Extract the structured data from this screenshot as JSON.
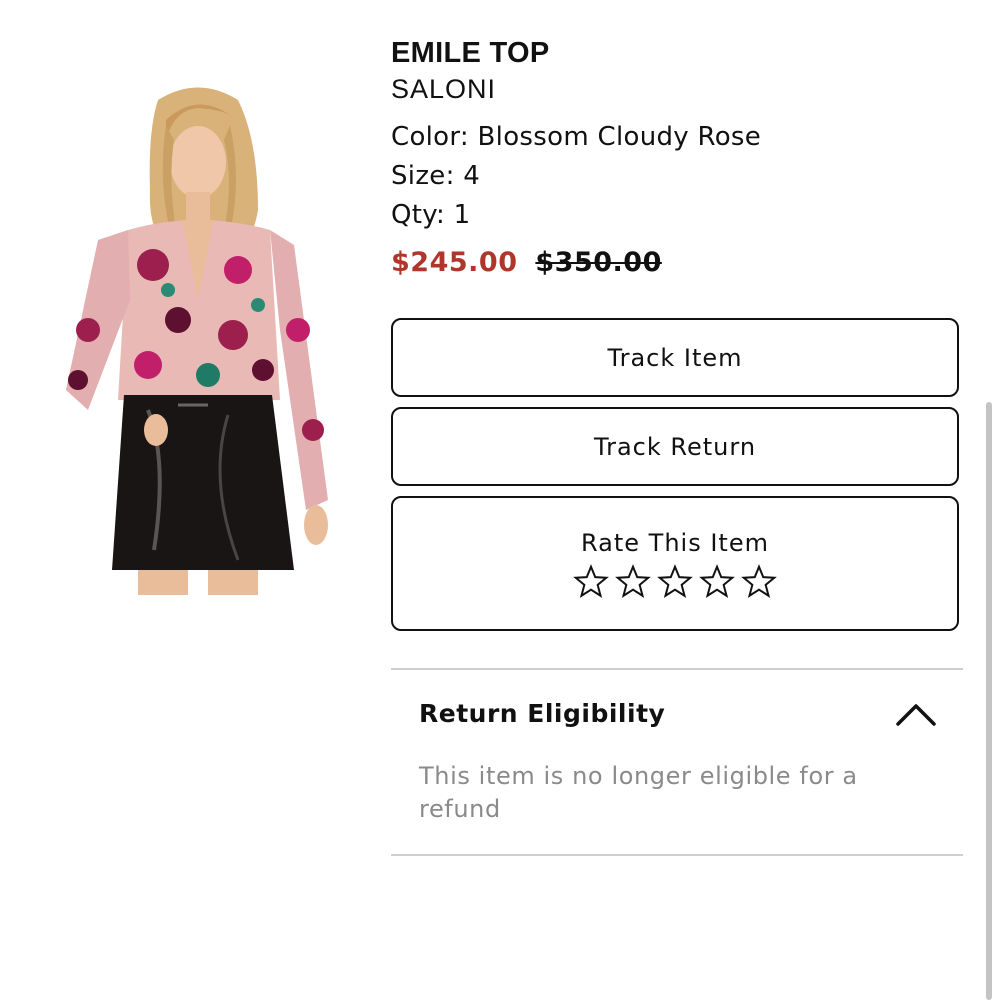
{
  "product": {
    "name": "EMILE TOP",
    "brand": "SALONI",
    "color_line": "Color: Blossom Cloudy Rose",
    "size_line": "Size: 4",
    "qty_line": "Qty: 1",
    "price_sale": "$245.00",
    "price_original": "$350.00",
    "image_alt": "model-wearing-floral-top-and-leather-skirt"
  },
  "actions": {
    "track_item": "Track Item",
    "track_return": "Track Return",
    "rate_label": "Rate This Item",
    "rating_max": 5,
    "rating_value": 0
  },
  "eligibility": {
    "title": "Return Eligibility",
    "message": "This item is no longer eligible for a refund",
    "expanded": true
  },
  "colors": {
    "sale_price": "#b0362b",
    "muted_text": "#8a8a8a",
    "border": "#111111",
    "divider": "#cfcfcf"
  },
  "icons": {
    "rating": "star-outline-icon",
    "collapse": "chevron-up-icon"
  }
}
